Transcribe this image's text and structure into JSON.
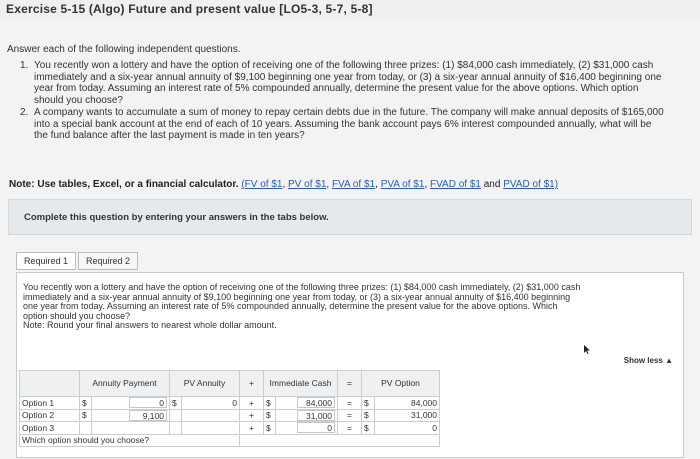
{
  "header": {
    "title": "Exercise 5-15 (Algo) Future and present value [LO5-3, 5-7, 5-8]"
  },
  "instructions": "Answer each of the following independent questions.",
  "questions": [
    {
      "num": "1.",
      "text": "You recently won a lottery and have the option of receiving one of the following three prizes: (1) $84,000 cash immediately, (2) $31,000 cash immediately and a six-year annual annuity of $9,100 beginning one year from today, or (3) a six-year annual annuity of $16,400 beginning one year from today. Assuming an interest rate of 5% compounded annually, determine the present value for the above options. Which option should you choose?"
    },
    {
      "num": "2.",
      "text": "A company wants to accumulate a sum of money to repay certain debts due in the future. The company will make annual deposits of $165,000 into a special bank account at the end of each of 10 years. Assuming the bank account pays 6% interest compounded annually, what will be the fund balance after the last payment is made in ten years?"
    }
  ],
  "note": {
    "prefix": "Note: Use tables, Excel, or a financial calculator.",
    "links": [
      "(FV of $1",
      "PV of $1",
      "FVA of $1",
      "PVA of $1",
      "FVAD of $1",
      "PVAD of $1)"
    ],
    "and_word": "and"
  },
  "complete_text": "Complete this question by entering your answers in the tabs below.",
  "tabs": [
    {
      "label": "Required 1"
    },
    {
      "label": "Required 2"
    }
  ],
  "problem": {
    "text": "You recently won a lottery and have the option of receiving one of the following three prizes: (1) $84,000 cash immediately, (2) $31,000 cash immediately and a six-year annual annuity of $9,100 beginning one year from today, or (3) a six-year annual annuity of $16,400 beginning one year from today. Assuming an interest rate of 5% compounded annually, determine the present value for the above options. Which option should you choose?",
    "note": "Note: Round your final answers to nearest whole dollar amount."
  },
  "show_less": "Show less ▲",
  "table": {
    "headers": {
      "annuity_payment": "Annuity Payment",
      "pv_annuity": "PV Annuity",
      "plus": "+",
      "immediate_cash": "Immediate Cash",
      "equals": "=",
      "pv_option": "PV Option"
    },
    "rows": [
      {
        "label": "Option 1",
        "annuity_cur": "$",
        "annuity": "0",
        "pv_cur": "$",
        "pv": "0",
        "plus": "+",
        "cash_cur": "$",
        "cash": "84,000",
        "eq": "=",
        "opt_cur": "$",
        "opt": "84,000"
      },
      {
        "label": "Option 2",
        "annuity_cur": "$",
        "annuity": "9,100",
        "pv_cur": "",
        "pv": "",
        "plus": "+",
        "cash_cur": "$",
        "cash": "31,000",
        "eq": "=",
        "opt_cur": "$",
        "opt": "31,000"
      },
      {
        "label": "Option 3",
        "annuity_cur": "",
        "annuity": "",
        "pv_cur": "",
        "pv": "",
        "plus": "+",
        "cash_cur": "$",
        "cash": "0",
        "eq": "=",
        "opt_cur": "$",
        "opt": "0"
      }
    ],
    "question_row": "Which option should you choose?"
  }
}
